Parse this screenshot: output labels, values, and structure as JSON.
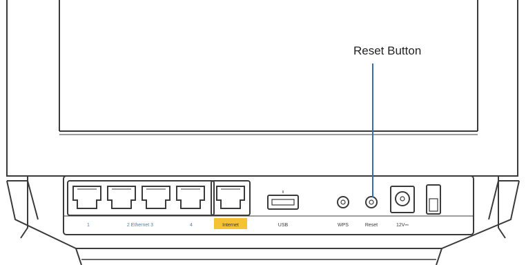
{
  "callout": {
    "label": "Reset Button",
    "line_color": "#2f6fb5"
  },
  "port_labels": {
    "ethernet_1": "1",
    "ethernet_group": "2  Ethernet  3",
    "ethernet_4": "4",
    "internet": "Internet",
    "usb": "USB",
    "wps": "WPS",
    "reset": "Reset",
    "power": "12V⎓"
  },
  "colors": {
    "outline": "#3a3a3a",
    "label_blue": "#4a7fc1",
    "internet_highlight": "#f4c233",
    "panel_fill": "#ffffff"
  }
}
